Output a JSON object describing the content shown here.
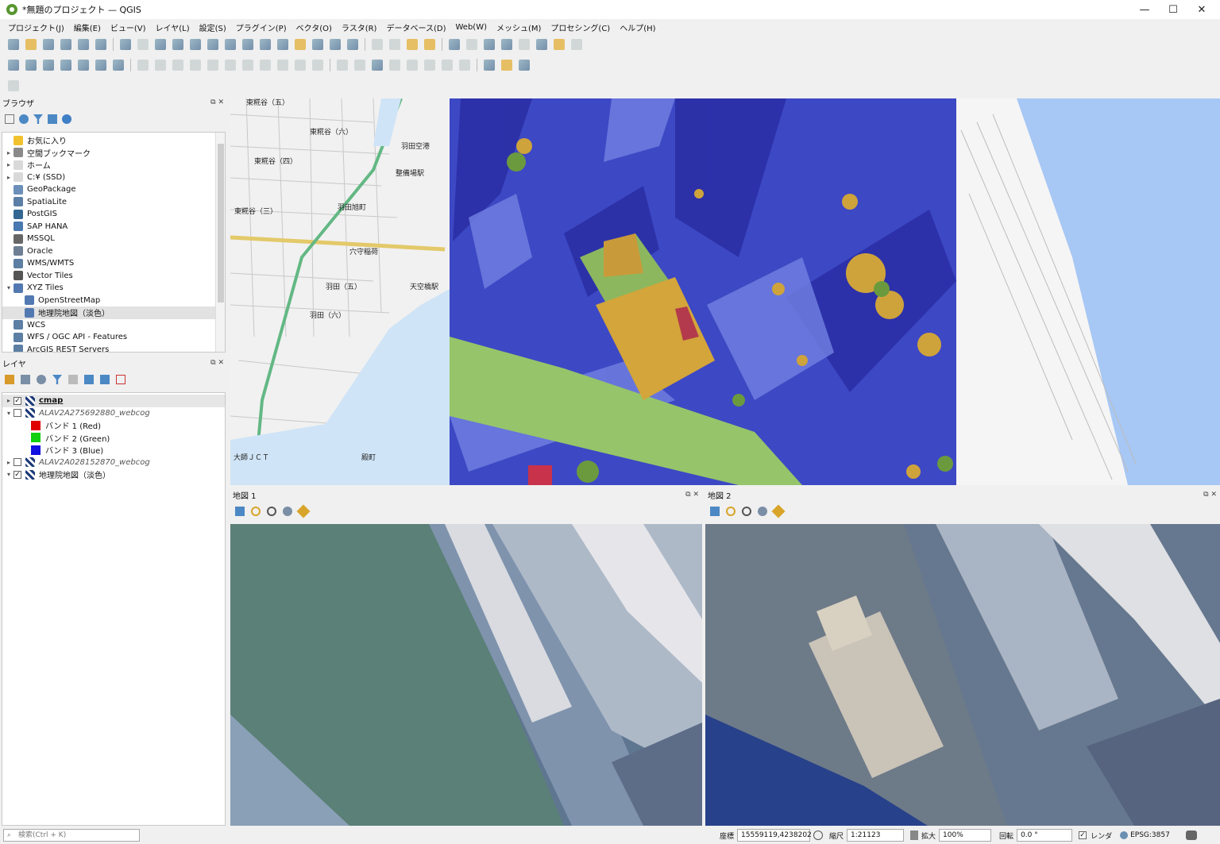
{
  "window": {
    "title": "*無題のプロジェクト — QGIS",
    "minimize": "—",
    "maximize": "☐",
    "close": "✕"
  },
  "menu": [
    "プロジェクト(J)",
    "編集(E)",
    "ビュー(V)",
    "レイヤ(L)",
    "設定(S)",
    "プラグイン(P)",
    "ベクタ(O)",
    "ラスタ(R)",
    "データベース(D)",
    "Web(W)",
    "メッシュ(M)",
    "プロセシング(C)",
    "ヘルプ(H)"
  ],
  "browser": {
    "title": "ブラウザ",
    "items": [
      {
        "label": "お気に入り",
        "icon": "star-icon",
        "color": "#f2c12e",
        "arrow": ""
      },
      {
        "label": "空間ブックマーク",
        "icon": "bookmark-icon",
        "color": "#8a8a8a",
        "arrow": "▸"
      },
      {
        "label": "ホーム",
        "icon": "folder-icon",
        "color": "#d9d9d9",
        "arrow": "▸"
      },
      {
        "label": "C:¥ (SSD)",
        "icon": "drive-icon",
        "color": "#d9d9d9",
        "arrow": "▸"
      },
      {
        "label": "GeoPackage",
        "icon": "geopackage-icon",
        "color": "#6b8fb8",
        "arrow": ""
      },
      {
        "label": "SpatiaLite",
        "icon": "spatialite-icon",
        "color": "#5b7fa6",
        "arrow": ""
      },
      {
        "label": "PostGIS",
        "icon": "postgis-icon",
        "color": "#336791",
        "arrow": ""
      },
      {
        "label": "SAP HANA",
        "icon": "sap-hana-icon",
        "color": "#4a78b0",
        "arrow": ""
      },
      {
        "label": "MSSQL",
        "icon": "mssql-icon",
        "color": "#666",
        "arrow": ""
      },
      {
        "label": "Oracle",
        "icon": "oracle-icon",
        "color": "#6e7f93",
        "arrow": ""
      },
      {
        "label": "WMS/WMTS",
        "icon": "wms-icon",
        "color": "#5c7fa3",
        "arrow": ""
      },
      {
        "label": "Vector Tiles",
        "icon": "vector-tiles-icon",
        "color": "#555",
        "arrow": ""
      },
      {
        "label": "XYZ Tiles",
        "icon": "xyz-tiles-icon",
        "color": "#5279b1",
        "arrow": "▾"
      },
      {
        "label": "OpenStreetMap",
        "icon": "xyz-layer-icon",
        "color": "#5279b1",
        "arrow": "",
        "indent": true
      },
      {
        "label": "地理院地図（淡色）",
        "icon": "xyz-layer-icon",
        "color": "#5279b1",
        "arrow": "",
        "indent": true,
        "selected": true
      },
      {
        "label": "WCS",
        "icon": "wcs-icon",
        "color": "#5c7fa3",
        "arrow": ""
      },
      {
        "label": "WFS / OGC API - Features",
        "icon": "wfs-icon",
        "color": "#5c7fa3",
        "arrow": ""
      },
      {
        "label": "ArcGIS REST Servers",
        "icon": "arcgis-icon",
        "color": "#5c7fa3",
        "arrow": ""
      }
    ]
  },
  "layers": {
    "title": "レイヤ",
    "items": [
      {
        "label": "cmap",
        "checked": true,
        "arrow": "▸",
        "style": "bold-underline"
      },
      {
        "label": "ALAV2A275692880_webcog",
        "checked": false,
        "arrow": "▾",
        "style": "italic"
      },
      {
        "label": "バンド 1 (Red)",
        "swatch": "#e00000",
        "band": true
      },
      {
        "label": "バンド 2 (Green)",
        "swatch": "#10d010",
        "band": true
      },
      {
        "label": "バンド 3 (Blue)",
        "swatch": "#1010e0",
        "band": true
      },
      {
        "label": "ALAV2A028152870_webcog",
        "checked": false,
        "arrow": "▸",
        "style": "italic"
      },
      {
        "label": "地理院地図（淡色）",
        "checked": true,
        "arrow": "▾",
        "style": "normal"
      }
    ]
  },
  "map_labels": [
    "東糀谷（五）",
    "東糀谷（六）",
    "東糀谷（四）",
    "東糀谷（三）",
    "羽田旭町",
    "穴守稲荷",
    "羽田（五）",
    "羽田（六）",
    "天空橋駅",
    "整備場駅",
    "羽田空港",
    "殿町",
    "大師ＪＣＴ"
  ],
  "map1": {
    "title": "地図 1"
  },
  "map2": {
    "title": "地図 2"
  },
  "status": {
    "search_placeholder": "検索(Ctrl + K)",
    "coord_label": "座標",
    "coord_value": "15559119,4238202",
    "scale_label": "縮尺",
    "scale_value": "1:21123",
    "magnifier_label": "拡大",
    "magnifier_value": "100%",
    "rotation_label": "回転",
    "rotation_value": "0.0 °",
    "render_label": "レンダ",
    "crs": "EPSG:3857"
  }
}
